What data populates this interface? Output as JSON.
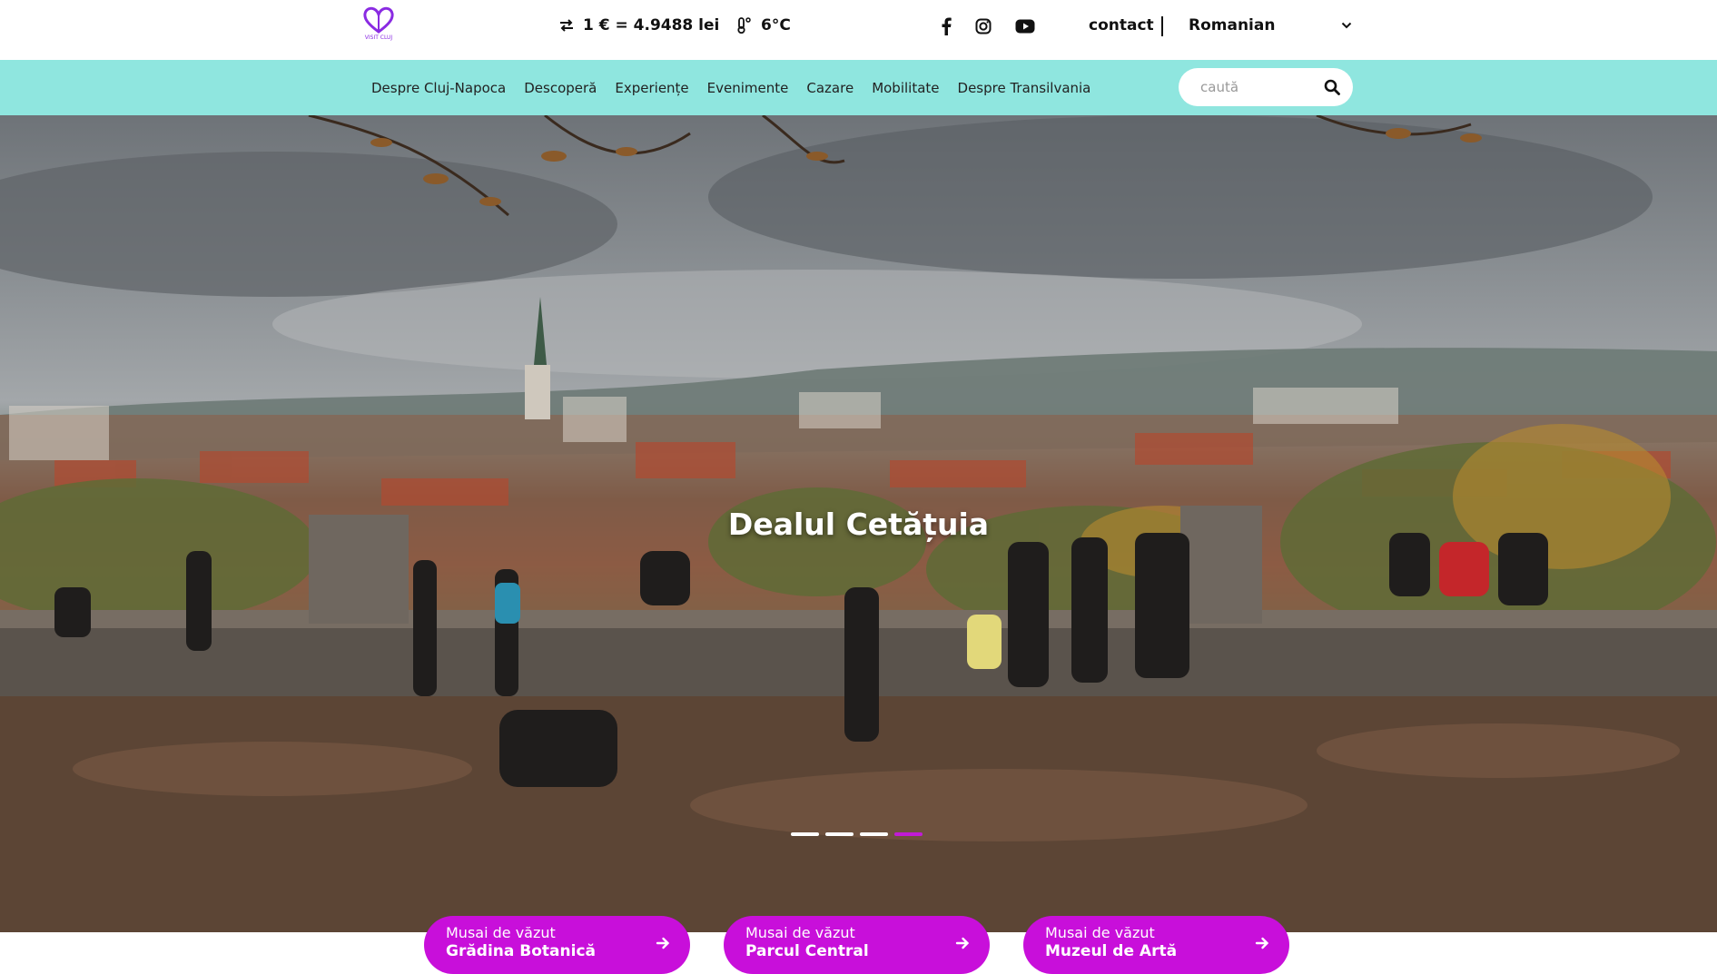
{
  "header": {
    "logo_text": "VISIT CLUJ",
    "exchange_rate": "1 € = 4.9488 lei",
    "temperature": "6°C",
    "contact_label": "contact",
    "language_selected": "Romanian"
  },
  "nav": {
    "items": [
      {
        "label": "Despre Cluj-Napoca"
      },
      {
        "label": "Descoperă"
      },
      {
        "label": "Experiențe"
      },
      {
        "label": "Evenimente"
      },
      {
        "label": "Cazare"
      },
      {
        "label": "Mobilitate"
      },
      {
        "label": "Despre Transilvania"
      }
    ],
    "search_placeholder": "caută"
  },
  "hero": {
    "title": "Dealul Cetățuia",
    "slide_count": 4,
    "active_slide": 4
  },
  "cards": [
    {
      "sub": "Musai de văzut",
      "main": "Grădina Botanică"
    },
    {
      "sub": "Musai de văzut",
      "main": "Parcul Central"
    },
    {
      "sub": "Musai de văzut",
      "main": "Muzeul de Artă"
    }
  ],
  "colors": {
    "accent": "#c80fda",
    "nav_bg": "#8fe6df",
    "logo": "#8a2be2"
  }
}
